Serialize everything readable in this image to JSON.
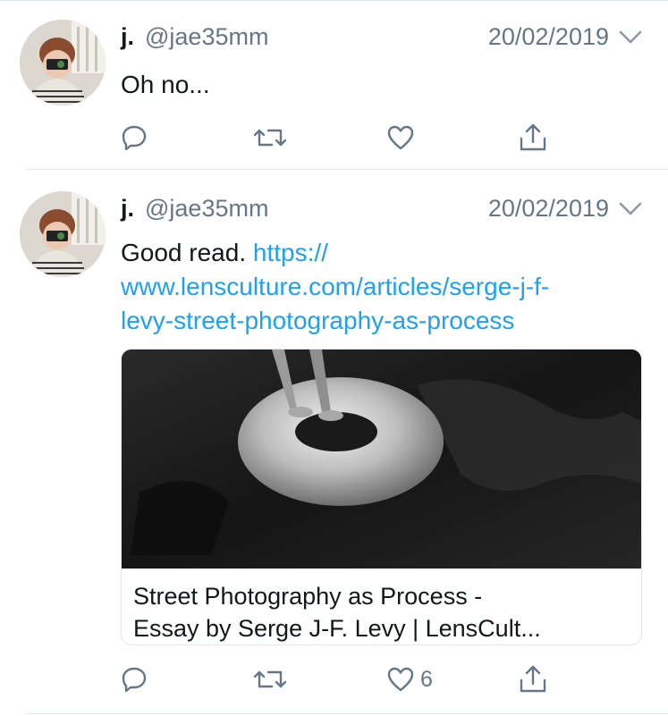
{
  "tweets": [
    {
      "name": "j.",
      "handle": "@jae35mm",
      "date": "20/02/2019",
      "text": "Oh no...",
      "like_count": ""
    },
    {
      "name": "j.",
      "handle": "@jae35mm",
      "date": "20/02/2019",
      "text": "Good read.",
      "link_line1": "https://",
      "link_line2": "www.lensculture.com/articles/serge-j-f-",
      "link_line3": "levy-street-photography-as-process",
      "card_title": "Street Photography as Process -\nEssay by Serge J-F. Levy | LensCult...",
      "like_count": "6"
    }
  ],
  "icons": {
    "reply": "reply-icon",
    "retweet": "retweet-icon",
    "like": "heart-icon",
    "share": "share-icon",
    "menu": "chevron-down-icon"
  },
  "colors": {
    "text": "#14171a",
    "muted": "#657786",
    "link": "#1da1f2",
    "divider": "#e1e8ed"
  }
}
